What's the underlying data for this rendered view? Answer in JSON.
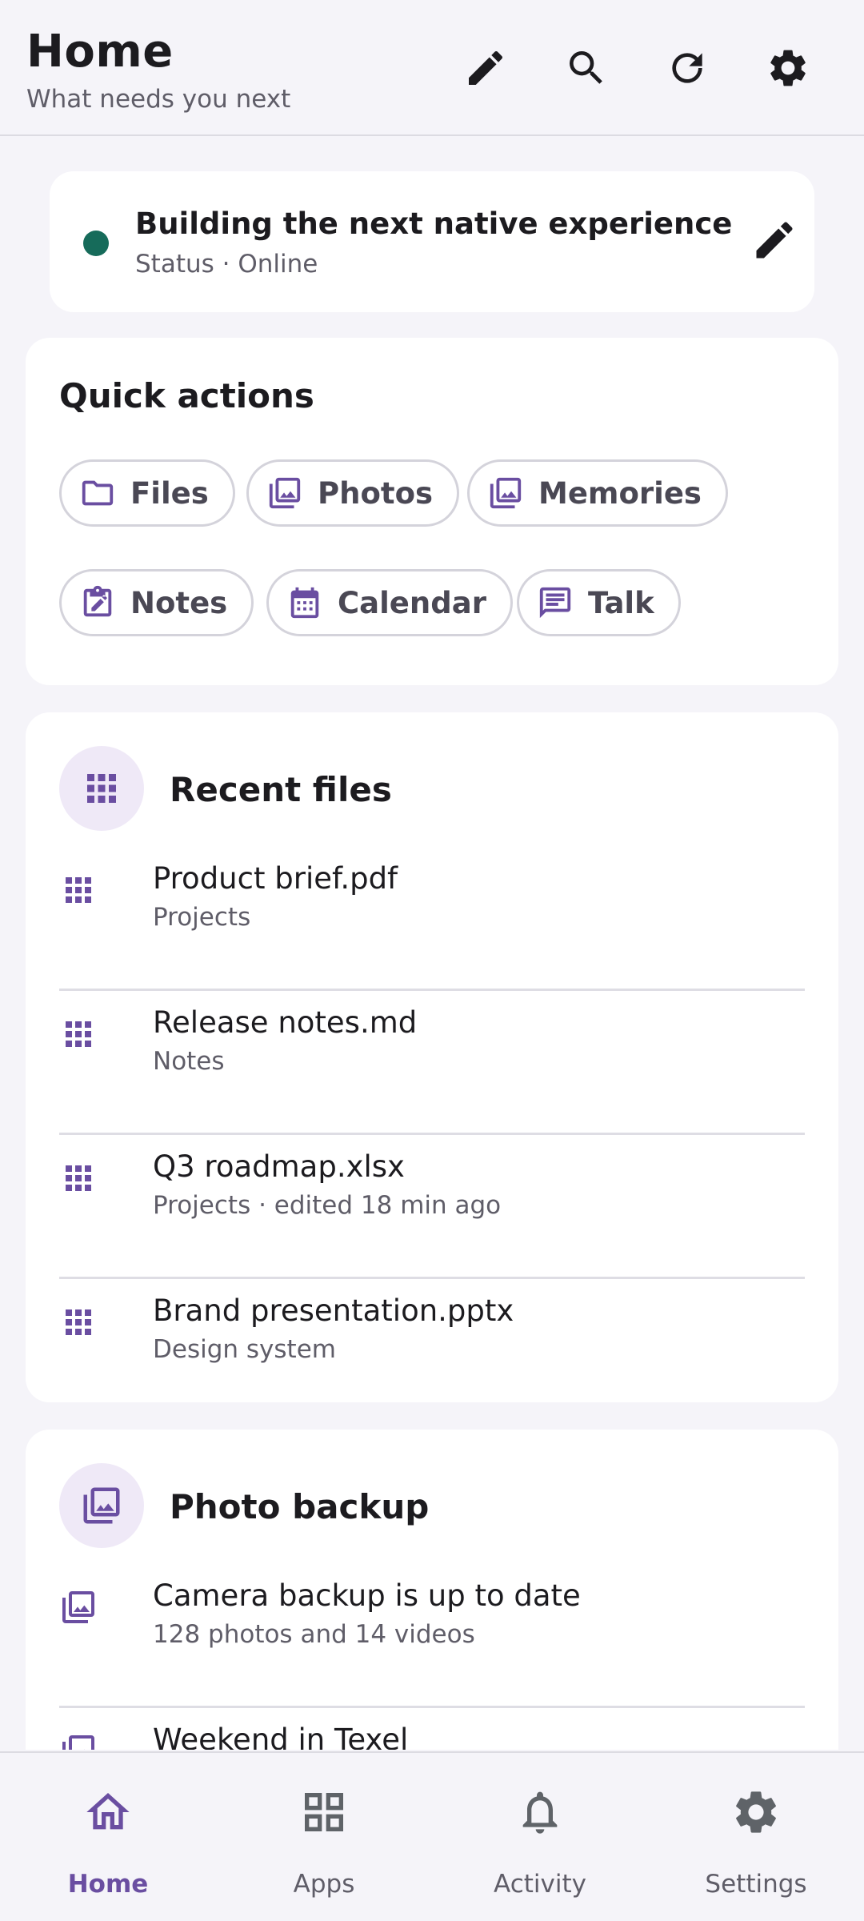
{
  "header": {
    "title": "Home",
    "subtitle": "What needs you next"
  },
  "status": {
    "title": "Building the next native experience",
    "subtitle": "Status · Online",
    "dot_color": "#166b5a"
  },
  "quick_actions": {
    "title": "Quick actions",
    "chips": [
      {
        "label": "Files",
        "icon": "folder-icon"
      },
      {
        "label": "Photos",
        "icon": "photos-icon"
      },
      {
        "label": "Memories",
        "icon": "photos-icon"
      },
      {
        "label": "Notes",
        "icon": "clipboard-icon"
      },
      {
        "label": "Calendar",
        "icon": "calendar-icon"
      },
      {
        "label": "Talk",
        "icon": "chat-icon"
      }
    ]
  },
  "recent_files": {
    "title": "Recent files",
    "items": [
      {
        "name": "Product brief.pdf",
        "meta": "Projects"
      },
      {
        "name": "Release notes.md",
        "meta": "Notes"
      },
      {
        "name": "Q3 roadmap.xlsx",
        "meta": "Projects · edited 18 min ago"
      },
      {
        "name": "Brand presentation.pptx",
        "meta": "Design system"
      }
    ]
  },
  "photo_backup": {
    "title": "Photo backup",
    "items": [
      {
        "name": "Camera backup is up to date",
        "meta": "128 photos and 14 videos"
      },
      {
        "name": "Weekend in Texel",
        "meta": ""
      }
    ]
  },
  "nav": {
    "items": [
      {
        "label": "Home",
        "icon": "home-icon",
        "active": true
      },
      {
        "label": "Apps",
        "icon": "apps-grid-icon",
        "active": false
      },
      {
        "label": "Activity",
        "icon": "bell-icon",
        "active": false
      },
      {
        "label": "Settings",
        "icon": "gear-icon",
        "active": false
      }
    ]
  },
  "colors": {
    "accent": "#6a4ea1",
    "background": "#f5f4f9",
    "card": "#ffffff"
  }
}
